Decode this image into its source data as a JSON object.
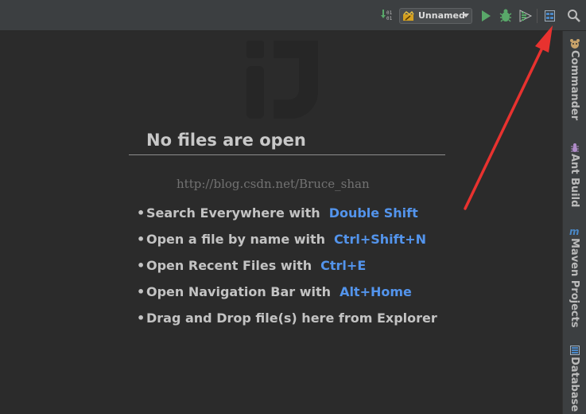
{
  "toolbar": {
    "run_config_label": "Unnamed"
  },
  "editor": {
    "empty_title": "No files are open",
    "watermark": "http://blog.csdn.net/Bruce_shan",
    "tips": [
      {
        "text": "Search Everywhere with",
        "shortcut": "Double Shift"
      },
      {
        "text": "Open a file by name with",
        "shortcut": "Ctrl+Shift+N"
      },
      {
        "text": "Open Recent Files with",
        "shortcut": "Ctrl+E"
      },
      {
        "text": "Open Navigation Bar with",
        "shortcut": "Alt+Home"
      },
      {
        "text": "Drag and Drop file(s) here from Explorer",
        "shortcut": ""
      }
    ]
  },
  "right_sidebar": {
    "tabs": [
      {
        "label": "Commander",
        "icon": "commander-icon"
      },
      {
        "label": "Ant Build",
        "icon": "ant-icon"
      },
      {
        "label": "Maven Projects",
        "icon": "maven-icon"
      },
      {
        "label": "Database",
        "icon": "database-icon"
      }
    ]
  },
  "colors": {
    "background": "#2b2b2b",
    "toolbar": "#3c3f41",
    "shortcut": "#5394ec",
    "annotation_arrow": "#e8322f",
    "run_green": "#59a869"
  }
}
